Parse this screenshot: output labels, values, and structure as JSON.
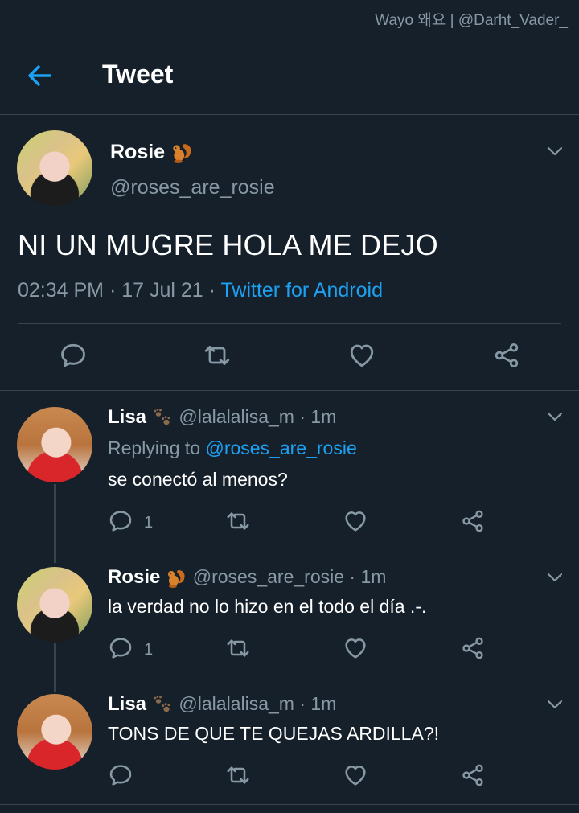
{
  "watermark": "Wayo 왜요 | @Darht_Vader_",
  "header": {
    "title": "Tweet",
    "back_icon": "arrow-left-icon"
  },
  "colors": {
    "background": "#15202b",
    "accent": "#1da1f2",
    "muted": "#8899a6",
    "divider": "#38444d"
  },
  "main_tweet": {
    "name": "Rosie",
    "name_emoji": "squirrel-icon",
    "handle": "@roses_are_rosie",
    "text": "NI UN MUGRE HOLA ME DEJO",
    "time": "02:34 PM",
    "date": "17 Jul 21",
    "client": "Twitter for Android"
  },
  "replies": [
    {
      "name": "Lisa",
      "name_emoji": "paw-prints-icon",
      "handle": "@lalalalisa_m",
      "age": "1m",
      "replying_prefix": "Replying to",
      "replying_to": "@roses_are_rosie",
      "text": "se conectó al menos?",
      "reply_count": "1"
    },
    {
      "name": "Rosie",
      "name_emoji": "squirrel-icon",
      "handle": "@roses_are_rosie",
      "age": "1m",
      "text": "la verdad no lo hizo en el todo el día .-.",
      "reply_count": "1"
    },
    {
      "name": "Lisa",
      "name_emoji": "paw-prints-icon",
      "handle": "@lalalalisa_m",
      "age": "1m",
      "text": "TONS DE QUE TE QUEJAS ARDILLA?!",
      "reply_count": ""
    }
  ],
  "separator": "·"
}
